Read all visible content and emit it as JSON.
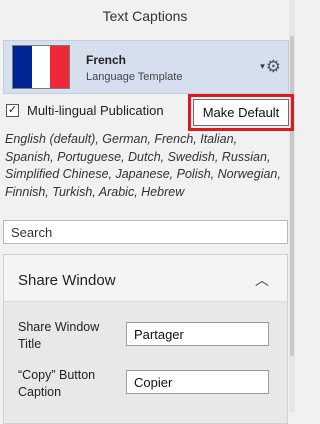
{
  "panel": {
    "title": "Text Captions"
  },
  "template": {
    "name": "French",
    "subtitle": "Language Template",
    "flag_colors": [
      "#002395",
      "#ffffff",
      "#ed2939"
    ],
    "menu_caret": "▾",
    "gear_glyph": "⚙"
  },
  "multilingual": {
    "label": "Multi-lingual Publication",
    "checked": true,
    "check_glyph": "✓"
  },
  "make_default": {
    "label": "Make Default",
    "highlight_color": "#e0171f"
  },
  "languages_text": "English (default), German, French, Italian, Spanish, Portuguese, Dutch, Swedish, Russian, Simplified Chinese, Japanese, Polish, Norwegian, Finnish, Turkish, Arabic, Hebrew",
  "search": {
    "label": "Search"
  },
  "share_window": {
    "title": "Share Window",
    "chevron": "︿",
    "fields": [
      {
        "label_line1": "Share Window",
        "label_line2": "Title",
        "value": "Partager"
      },
      {
        "label_line1": "“Copy” Button",
        "label_line2": "Caption",
        "value": "Copier"
      }
    ]
  }
}
